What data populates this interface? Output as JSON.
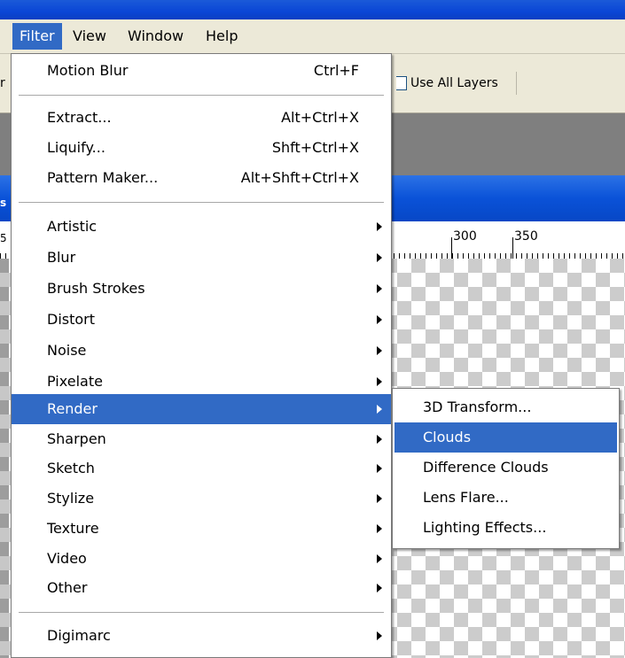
{
  "menubar": {
    "items": [
      "Filter",
      "View",
      "Window",
      "Help"
    ]
  },
  "options_bar": {
    "left_edge_text": "r",
    "use_all_layers_label": "Use All Layers"
  },
  "document": {
    "title_edge_text": "s"
  },
  "ruler": {
    "edge_label": "5",
    "labels": [
      "300",
      "350"
    ]
  },
  "filter_menu": {
    "last_filter": {
      "label": "Motion Blur",
      "shortcut": "Ctrl+F"
    },
    "tools": [
      {
        "label": "Extract...",
        "shortcut": "Alt+Ctrl+X"
      },
      {
        "label": "Liquify...",
        "shortcut": "Shft+Ctrl+X"
      },
      {
        "label": "Pattern Maker...",
        "shortcut": "Alt+Shft+Ctrl+X"
      }
    ],
    "categories": [
      "Artistic",
      "Blur",
      "Brush Strokes",
      "Distort",
      "Noise",
      "Pixelate",
      "Render",
      "Sharpen",
      "Sketch",
      "Stylize",
      "Texture",
      "Video",
      "Other"
    ],
    "highlighted_category": "Render",
    "extra": [
      "Digimarc"
    ]
  },
  "render_submenu": {
    "items": [
      "3D Transform...",
      "Clouds",
      "Difference Clouds",
      "Lens Flare...",
      "Lighting Effects..."
    ],
    "highlighted": "Clouds"
  },
  "colors": {
    "highlight": "#316ac5",
    "menubar_bg": "#ece9d8",
    "title_blue": "#0a46d6"
  }
}
